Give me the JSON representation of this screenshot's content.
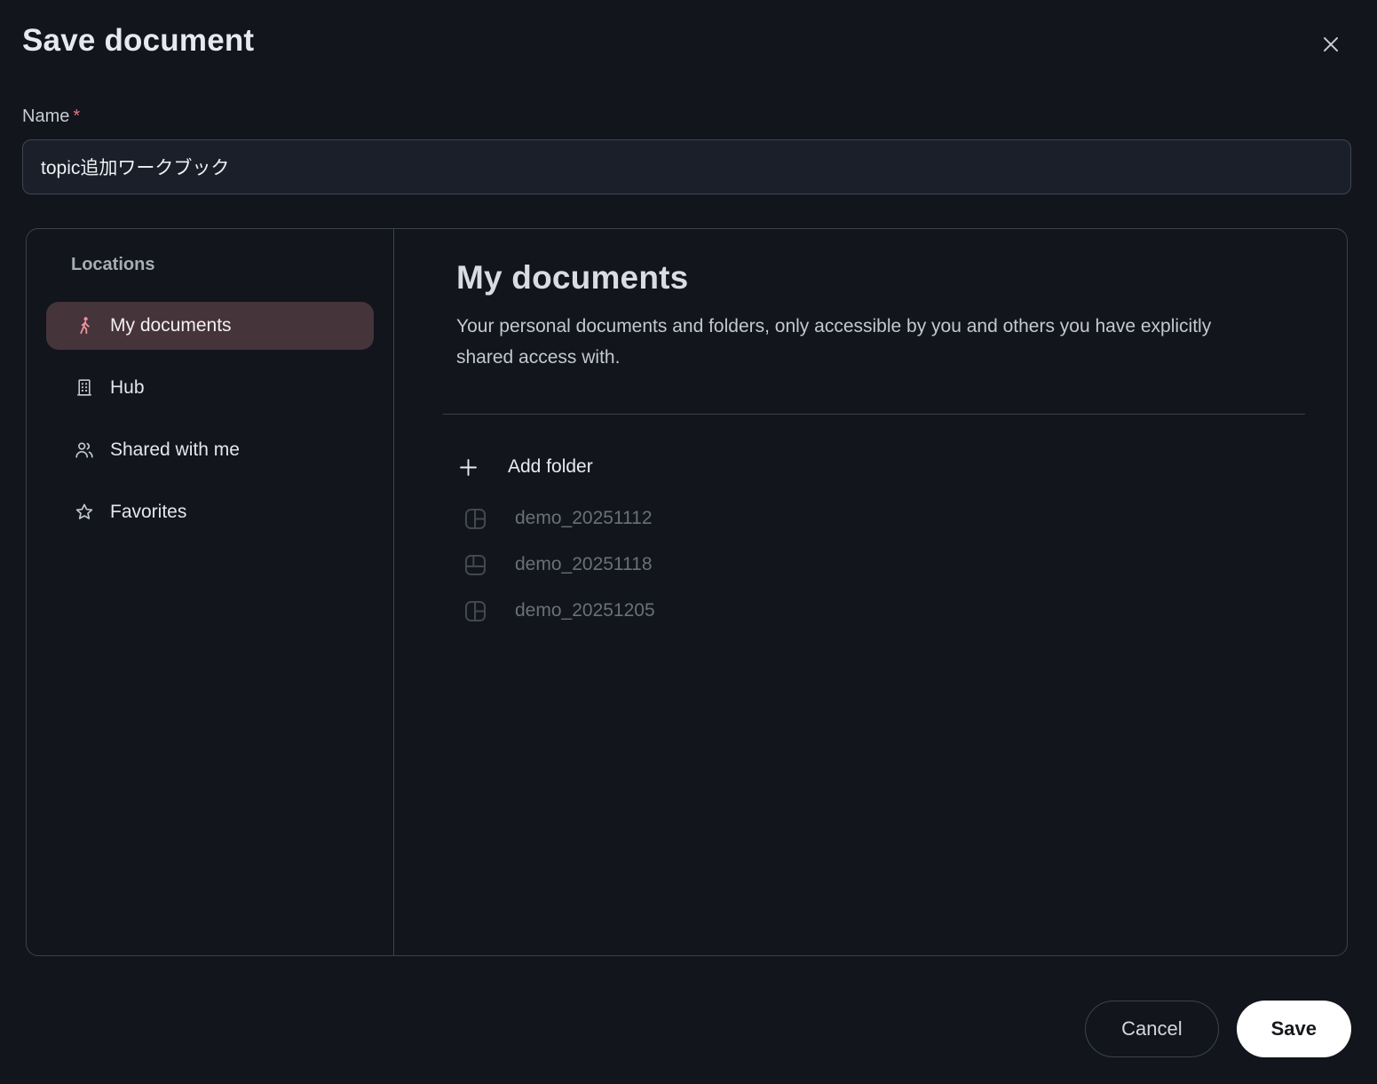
{
  "dialog": {
    "title": "Save document"
  },
  "name_field": {
    "label": "Name",
    "required_marker": "*",
    "value": "topic追加ワークブック"
  },
  "sidebar": {
    "header": "Locations",
    "items": [
      {
        "label": "My documents",
        "icon": "person-walking-icon",
        "selected": true
      },
      {
        "label": "Hub",
        "icon": "building-icon",
        "selected": false
      },
      {
        "label": "Shared with me",
        "icon": "people-icon",
        "selected": false
      },
      {
        "label": "Favorites",
        "icon": "star-icon",
        "selected": false
      }
    ]
  },
  "content": {
    "heading": "My documents",
    "description": "Your personal documents and folders, only accessible by you and others you have explicitly shared access with.",
    "add_folder_label": "Add folder",
    "folders": [
      {
        "name": "demo_20251112",
        "icon": "workbook-layout-icon"
      },
      {
        "name": "demo_20251118",
        "icon": "workbook-layout-icon"
      },
      {
        "name": "demo_20251205",
        "icon": "workbook-layout-icon"
      }
    ]
  },
  "footer": {
    "cancel_label": "Cancel",
    "save_label": "Save"
  },
  "colors": {
    "background": "#12151b",
    "panel_border": "#3b414e",
    "selected_item_bg": "#45343a",
    "accent_pink": "#f0939e",
    "required_red": "#e5737d",
    "input_bg": "#1a1f29",
    "muted_text": "#697079",
    "save_button_bg": "#ffffff"
  }
}
